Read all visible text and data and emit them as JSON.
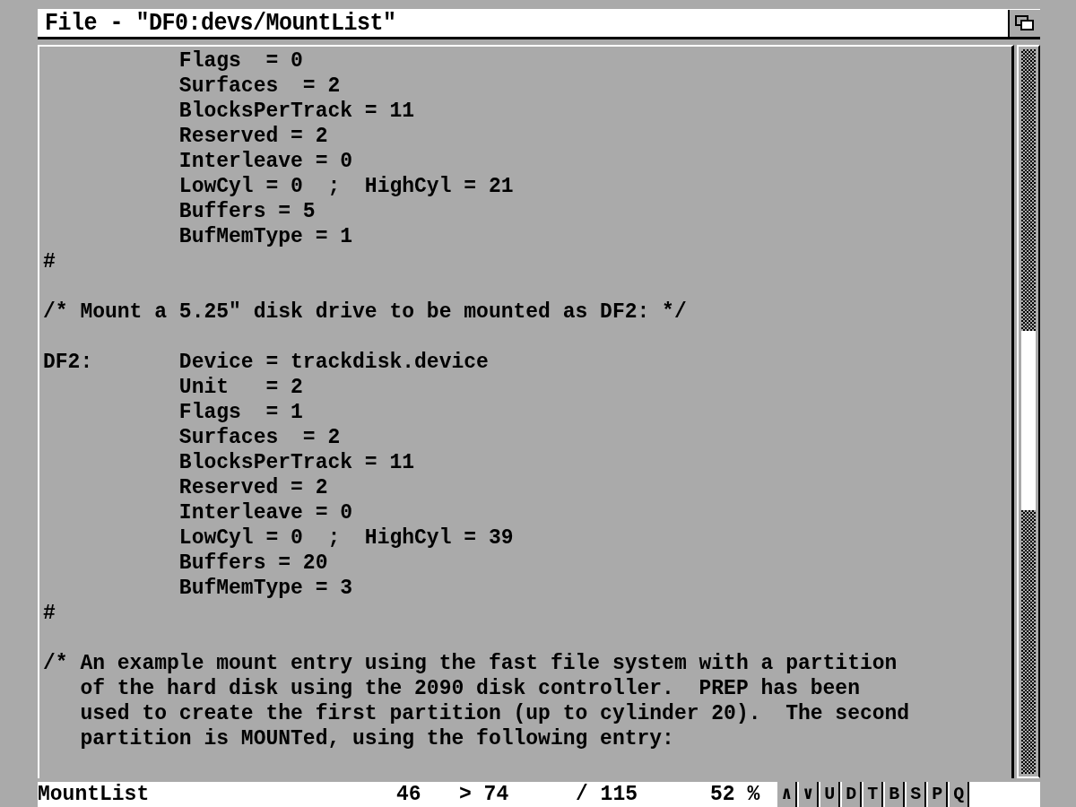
{
  "window": {
    "title": "File - \"DF0:devs/MountList\""
  },
  "lines": [
    {
      "kind": "text",
      "text": "           Flags  = 0"
    },
    {
      "kind": "text",
      "text": "           Surfaces  = 2"
    },
    {
      "kind": "text",
      "text": "           BlocksPerTrack = 11"
    },
    {
      "kind": "text",
      "text": "           Reserved = 2"
    },
    {
      "kind": "text",
      "text": "           Interleave = 0"
    },
    {
      "kind": "text",
      "text": "           LowCyl = 0  ;  HighCyl = 21"
    },
    {
      "kind": "text",
      "text": "           Buffers = 5"
    },
    {
      "kind": "text",
      "text": "           BufMemType = 1"
    },
    {
      "kind": "text",
      "text": "#"
    },
    {
      "kind": "blank"
    },
    {
      "kind": "text",
      "text": "/* Mount a 5.25\" disk drive to be mounted as DF2: */"
    },
    {
      "kind": "blank"
    },
    {
      "kind": "text",
      "text": "DF2:       Device = trackdisk.device"
    },
    {
      "kind": "text",
      "text": "           Unit   = 2"
    },
    {
      "kind": "text",
      "text": "           Flags  = 1"
    },
    {
      "kind": "text",
      "text": "           Surfaces  = 2"
    },
    {
      "kind": "text",
      "text": "           BlocksPerTrack = 11"
    },
    {
      "kind": "text",
      "text": "           Reserved = 2"
    },
    {
      "kind": "text",
      "text": "           Interleave = 0"
    },
    {
      "kind": "text",
      "text": "           LowCyl = 0  ;  HighCyl = 39"
    },
    {
      "kind": "text",
      "text": "           Buffers = 20"
    },
    {
      "kind": "text",
      "text": "           BufMemType = 3"
    },
    {
      "kind": "text",
      "text": "#"
    },
    {
      "kind": "blank"
    },
    {
      "kind": "text",
      "text": "/* An example mount entry using the fast file system with a partition"
    },
    {
      "kind": "text",
      "text": "   of the hard disk using the 2090 disk controller.  PREP has been"
    },
    {
      "kind": "text",
      "text": "   used to create the first partition (up to cylinder 20).  The second"
    },
    {
      "kind": "text",
      "text": "   partition is MOUNTed, using the following entry:"
    }
  ],
  "status_bar": {
    "file_name": "MountList",
    "first_line": "46",
    "last_line": "> 74",
    "total_lines": "/ 115",
    "percent": "52 %",
    "buttons": [
      "∧",
      "∨",
      "U",
      "D",
      "T",
      "B",
      "S",
      "P",
      "Q"
    ]
  }
}
